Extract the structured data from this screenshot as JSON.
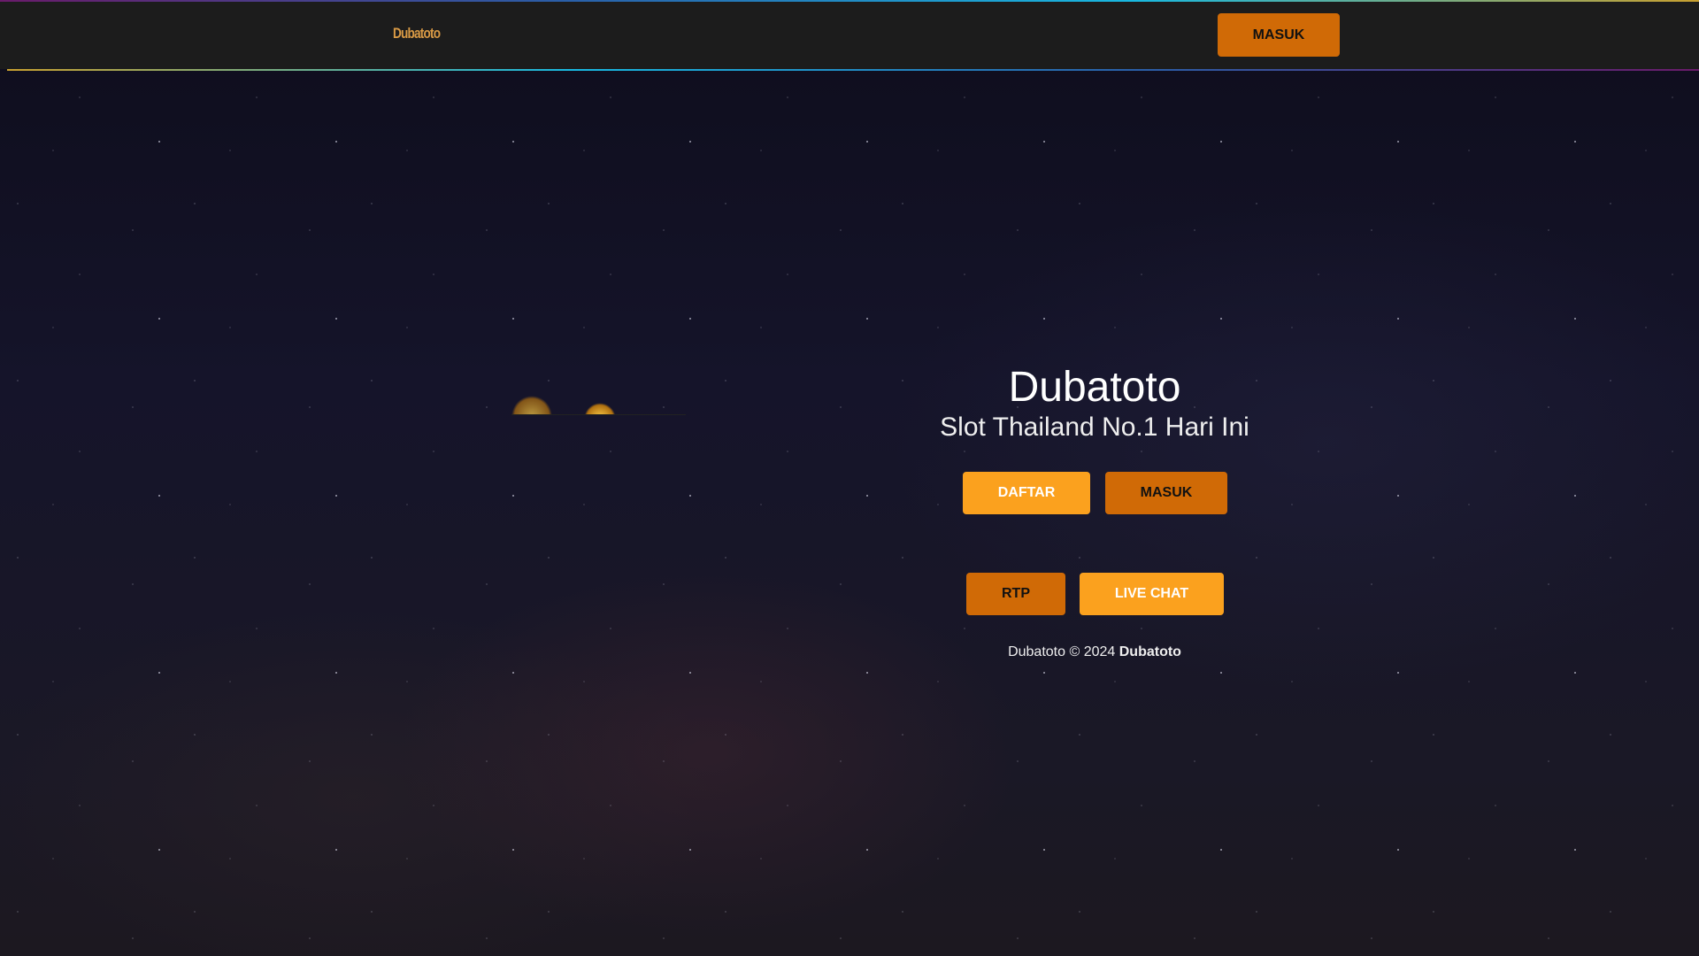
{
  "header": {
    "logo": "Dubatoto",
    "login_button": "MASUK"
  },
  "hero": {
    "title": "Dubatoto",
    "subtitle": "Slot Thailand No.1 Hari Ini",
    "buttons": {
      "register": "DAFTAR",
      "login": "MASUK",
      "rtp": "RTP",
      "live_chat": "LIVE CHAT"
    }
  },
  "footer": {
    "brand": "Dubatoto",
    "copyright": "© 2024",
    "owner": "Dubatoto"
  },
  "colors": {
    "primary": "#d06a06",
    "secondary": "#fba11e",
    "header": "#1c1c1c"
  }
}
